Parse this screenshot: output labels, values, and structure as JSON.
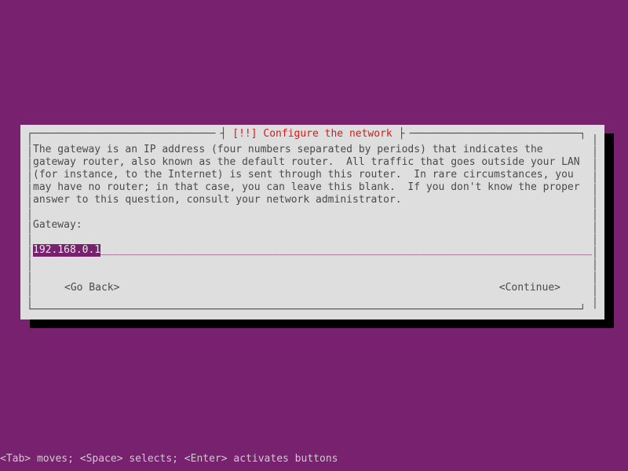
{
  "dialog": {
    "title_priority": "[!!]",
    "title": "Configure the network",
    "description": "The gateway is an IP address (four numbers separated by periods) that indicates the\ngateway router, also known as the default router.  All traffic that goes outside your LAN\n(for instance, to the Internet) is sent through this router.  In rare circumstances, you\nmay have no router; in that case, you can leave this blank.  If you don't know the proper\nanswer to this question, consult your network administrator.",
    "field_label": "Gateway:",
    "input_value": "192.168.0.1",
    "buttons": {
      "back": "<Go Back>",
      "continue": "<Continue>"
    }
  },
  "help_bar": "<Tab> moves; <Space> selects; <Enter> activates buttons"
}
